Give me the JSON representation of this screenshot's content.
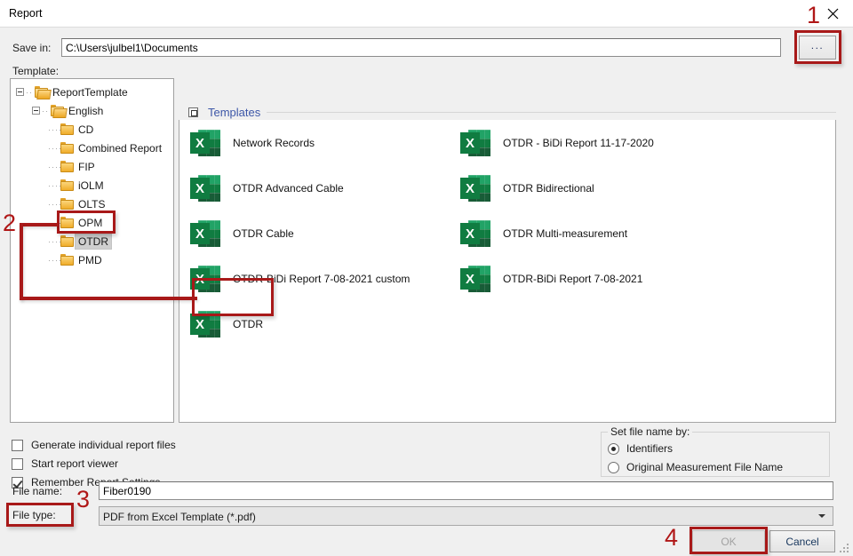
{
  "window": {
    "title": "Report",
    "close_icon": "close-icon"
  },
  "save_in": {
    "label": "Save in:",
    "value": "C:\\Users\\julbel1\\Documents",
    "browse_label": "..."
  },
  "template_label": "Template:",
  "tree": {
    "items": [
      {
        "label": "ReportTemplate",
        "depth": 0,
        "expandable": true,
        "open": true,
        "selected": false
      },
      {
        "label": "English",
        "depth": 1,
        "expandable": true,
        "open": true,
        "selected": false
      },
      {
        "label": "CD",
        "depth": 2,
        "expandable": false,
        "open": false,
        "selected": false
      },
      {
        "label": "Combined Report",
        "depth": 2,
        "expandable": false,
        "open": false,
        "selected": false
      },
      {
        "label": "FIP",
        "depth": 2,
        "expandable": false,
        "open": false,
        "selected": false
      },
      {
        "label": "iOLM",
        "depth": 2,
        "expandable": false,
        "open": false,
        "selected": false
      },
      {
        "label": "OLTS",
        "depth": 2,
        "expandable": false,
        "open": false,
        "selected": false
      },
      {
        "label": "OPM",
        "depth": 2,
        "expandable": false,
        "open": false,
        "selected": false
      },
      {
        "label": "OTDR",
        "depth": 2,
        "expandable": false,
        "open": false,
        "selected": true
      },
      {
        "label": "PMD",
        "depth": 2,
        "expandable": false,
        "open": false,
        "selected": false
      }
    ]
  },
  "templates": {
    "group_title": "Templates",
    "icon": "excel-file-icon",
    "column_left": [
      "Network Records",
      "OTDR Advanced Cable",
      "OTDR Cable",
      "OTDR-BiDi Report 7-08-2021 custom",
      "OTDR"
    ],
    "column_right": [
      "OTDR - BiDi Report 11-17-2020",
      "OTDR Bidirectional",
      "OTDR Multi-measurement",
      "OTDR-BiDi Report 7-08-2021"
    ]
  },
  "options": {
    "checkboxes": [
      {
        "label": "Generate individual report files",
        "checked": false
      },
      {
        "label": "Start report viewer",
        "checked": false
      },
      {
        "label": "Remember Report Settings",
        "checked": true
      }
    ]
  },
  "set_file_name_by": {
    "title": "Set file name by:",
    "options": [
      {
        "label": "Identifiers",
        "selected": true
      },
      {
        "label": "Original Measurement File Name",
        "selected": false
      }
    ]
  },
  "file_name": {
    "label": "File name:",
    "value": "Fiber0190"
  },
  "file_type": {
    "label": "File type:",
    "value": "PDF from Excel Template (*.pdf)"
  },
  "buttons": {
    "ok": "OK",
    "ok_enabled": false,
    "cancel": "Cancel"
  },
  "annotations": {
    "n1": "1",
    "n2": "2",
    "n3": "3",
    "n4": "4",
    "color": "#a81919"
  }
}
